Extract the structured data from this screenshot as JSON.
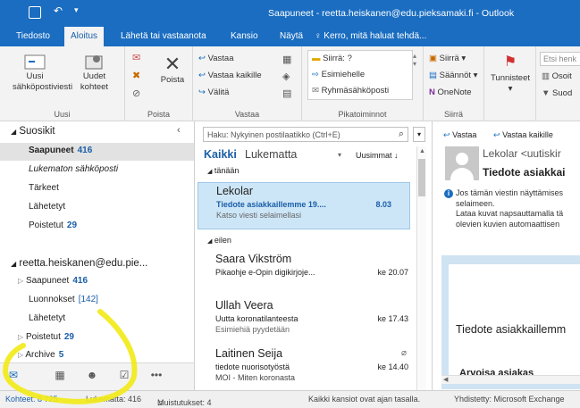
{
  "titlebar": {
    "title": "Saapuneet - reetta.heiskanen@edu.pieksamaki.fi - Outlook"
  },
  "menu": {
    "tabs": [
      "Tiedosto",
      "Aloitus",
      "Lähetä tai vastaanota",
      "Kansio",
      "Näytä"
    ],
    "tell_me": "Kerro, mitä haluat tehdä..."
  },
  "ribbon": {
    "new_email": [
      "Uusi",
      "sähköpostiviesti"
    ],
    "new_items": [
      "Uudet",
      "kohteet"
    ],
    "delete": "Poista",
    "reply": "Vastaa",
    "reply_all": "Vastaa kaikille",
    "forward": "Välitä",
    "quick_steps": [
      "Siirrä: ?",
      "Esimiehelle",
      "Ryhmäsähköposti"
    ],
    "move": "Siirrä",
    "rules": "Säännöt",
    "onenote": "OneNote",
    "tags": "Tunnisteet",
    "search_people": "Etsi henk",
    "address_book": "Osoit",
    "filter": "Suod",
    "groups": [
      "Uusi",
      "Poista",
      "Vastaa",
      "Pikatoiminnot",
      "Siirrä"
    ]
  },
  "folders": {
    "favorites": "Suosikit",
    "fav_items": [
      {
        "name": "Saapuneet",
        "count": "416"
      },
      {
        "name": "Lukematon sähköposti",
        "count": ""
      },
      {
        "name": "Tärkeet",
        "count": ""
      },
      {
        "name": "Lähetetyt",
        "count": ""
      },
      {
        "name": "Poistetut",
        "count": "29"
      }
    ],
    "account": "reetta.heiskanen@edu.pie...",
    "acc_items": [
      {
        "name": "Saapuneet",
        "count": "416"
      },
      {
        "name": "Luonnokset",
        "count": "[142]"
      },
      {
        "name": "Lähetetyt",
        "count": ""
      },
      {
        "name": "Poistetut",
        "count": "29"
      },
      {
        "name": "Archive",
        "count": "5"
      }
    ]
  },
  "list": {
    "search_placeholder": "Haku: Nykyinen postilaatikko (Ctrl+E)",
    "filter_all": "Kaikki",
    "filter_unread": "Lukematta",
    "sort": "Uusimmat",
    "group_today": "tänään",
    "group_yesterday": "eilen",
    "messages": [
      {
        "sender": "Lekolar",
        "subject": "Tiedote asiakkaillemme 19....",
        "preview": "Katso viesti selaimellasi",
        "date": "8.03"
      },
      {
        "sender": "Saara Vikström",
        "subject": "Pikaohje e-Opin digikirjoje...",
        "preview": "",
        "date": "ke 20.07"
      },
      {
        "sender": "Ullah Veera",
        "subject": "Uutta koronatilanteesta",
        "preview": "Esimiehiä pyydetään",
        "date": "ke 17.43"
      },
      {
        "sender": "Laitinen Seija",
        "subject": "tiedote nuorisotyöstä",
        "preview": "MOI - Miten koronasta",
        "date": "ke 14.40"
      }
    ]
  },
  "reading": {
    "reply": "Vastaa",
    "reply_all": "Vastaa kaikille",
    "from": "Lekolar <uutiskir",
    "subject": "Tiedote asiakkai",
    "info_lines": [
      "Jos tämän viestin näyttämises",
      "selaimeen.",
      "Lataa kuvat napsauttamalla tä",
      "olevien kuvien automaattisen"
    ],
    "body_title": "Tiedote asiakkaillemm",
    "body_sub": "Arvoisa asiakas"
  },
  "status": {
    "items": "Kohteet: 8 725",
    "unread": "Lukematta: 416",
    "reminders": "Muistutukset: 4",
    "sync": "Kaikki kansiot ovat ajan tasalla.",
    "connected": "Yhdistetty: Microsoft Exchange"
  },
  "colors": {
    "accent": "#1a6dc1",
    "highlight": "#f2ea1a",
    "selected": "#cde6f7"
  }
}
